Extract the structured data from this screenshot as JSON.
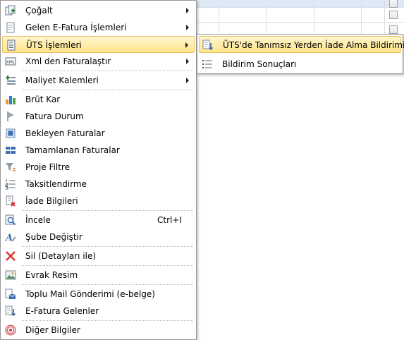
{
  "menu": {
    "items": [
      {
        "label": "Çoğalt",
        "submenu": true
      },
      {
        "label": "Gelen E-Fatura İşlemleri",
        "submenu": true
      },
      {
        "label": "ÜTS İşlemleri",
        "submenu": true
      },
      {
        "label": "Xml den Faturalaştır",
        "submenu": true
      },
      {
        "label": "Maliyet Kalemleri",
        "submenu": true
      },
      {
        "label": "Brüt Kar"
      },
      {
        "label": "Fatura Durum"
      },
      {
        "label": "Bekleyen Faturalar"
      },
      {
        "label": "Tamamlanan Faturalar"
      },
      {
        "label": "Proje Filtre"
      },
      {
        "label": "Taksitlendirme"
      },
      {
        "label": "İade Bilgileri"
      },
      {
        "label": "İncele",
        "shortcut": "Ctrl+I"
      },
      {
        "label": "Şube Değiştir"
      },
      {
        "label": "Sil (Detayları ile)"
      },
      {
        "label": "Evrak Resim"
      },
      {
        "label": "Toplu Mail Gönderimi (e-belge)"
      },
      {
        "label": "E-Fatura Gelenler"
      },
      {
        "label": "Diğer Bilgiler"
      }
    ]
  },
  "submenu": {
    "items": [
      {
        "label": "ÜTS'de Tanımsız Yerden İade Alma Bildirimi"
      },
      {
        "label": "Bildirim Sonuçları"
      }
    ]
  },
  "colors": {
    "highlight_top": "#fff6cc",
    "highlight_bottom": "#fde58c",
    "highlight_border": "#e5c365",
    "grid_highlight": "#dde9f7"
  }
}
